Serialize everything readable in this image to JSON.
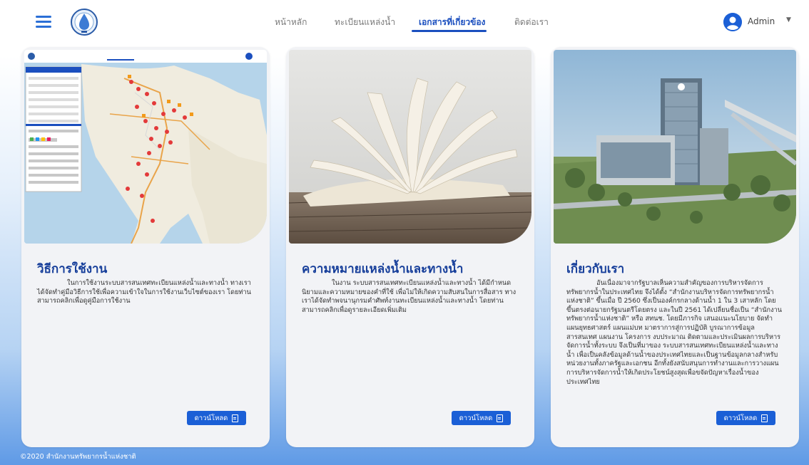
{
  "header": {
    "nav": [
      {
        "label": "หน้าหลัก",
        "active": false
      },
      {
        "label": "ทะเบียนแหล่งน้ำ",
        "active": false
      },
      {
        "label": "เอกสารที่เกี่ยวข้อง",
        "active": true
      },
      {
        "label": "ติดต่อเรา",
        "active": false
      }
    ],
    "user_name": "Admin",
    "icons": {
      "menu": "hamburger-icon",
      "avatar": "user-circle-icon",
      "caret": "caret-down-icon"
    }
  },
  "cards": [
    {
      "title": "วิธีการใช้งาน",
      "text": "ในการใช้งานระบบสารสนเทศทะเบียนแหล่งน้ำและทางน้ำ ทางเราได้จัดทำคู่มือวิธีการใช้เพื่อความเข้าใจในการใช้งานเว็บไซต์ของเรา โดยท่านสามารถคลิกเพื่อดูคู่มือการใช้งาน",
      "button": "ดาวน์โหลด",
      "image": "map-screenshot"
    },
    {
      "title": "ความหมายแหล่งน้ำและทางน้ำ",
      "text": "ในงาน ระบบสารสนเทศทะเบียนแหล่งน้ำและทางน้ำ ได้มีกำหนดนิยามและความหมายของคำที่ใช้ เพื่อไม่ให้เกิดความสับสนในการสื่อสาร ทางเราได้จัดทำพจนานุกรมคำศัพท์งานทะเบียนแหล่งน้ำและทางน้ำ โดยท่านสามารถคลิกเพื่อดูรายละเอียดเพิ่มเติม",
      "button": "ดาวน์โหลด",
      "image": "open-book-photo"
    },
    {
      "title": "เกี่ยวกับเรา",
      "text": "อันเนื่องมาจากรัฐบาลเห็นความสำคัญของการบริหารจัดการทรัพยากรน้ำในประเทศไทย จึงได้ตั้ง “สำนักงานบริหารจัดการทรัพยากรน้ำแห่งชาติ” ขึ้นเมื่อ ปี 2560 ซึ่งเป็นองค์กรกลางด้านน้ำ 1 ใน 3 เสาหลัก โดยขึ้นตรงต่อนายกรัฐมนตรีโดยตรง และในปี 2561 ได้เปลี่ยนชื่อเป็น “สำนักงานทรัพยากรน้ำแห่งชาติ” หรือ สทนช. โดยมีภารกิจ เสนอแนะนโยบาย จัดทำแผนยุทธศาสตร์ แผนแม่บท มาตราการสู่การปฏิบัติ บูรณาการข้อมูลสารสนเทศ แผนงาน โครงการ งบประมาณ ติดตามและประเมินผลการบริหารจัดการน้ำทั้งระบบ จึงเป็นที่มาของ ระบบสารสนเทศทะเบียนแหล่งน้ำและทางน้ำ เพื่อเป็นคลังข้อมูลด้านน้ำของประเทศไทยและเป็นฐานข้อมูลกลางสำหรับหน่วยงานทั้งภาครัฐและเอกชน อีกทั้งยังสนับสนุนการทำงานและการวางแผนการบริหารจัดการน้ำให้เกิดประโยชน์สูงสุดเพื่อขจัดปัญหาเรื่องน้ำของประเทศไทย",
      "button": "ดาวน์โหลด",
      "image": "office-building-photo"
    }
  ],
  "footer": "©2020 สำนักงานทรัพยากรน้ำแห่งชาติ",
  "colors": {
    "accent": "#1b5fd6",
    "title": "#163e9a"
  }
}
